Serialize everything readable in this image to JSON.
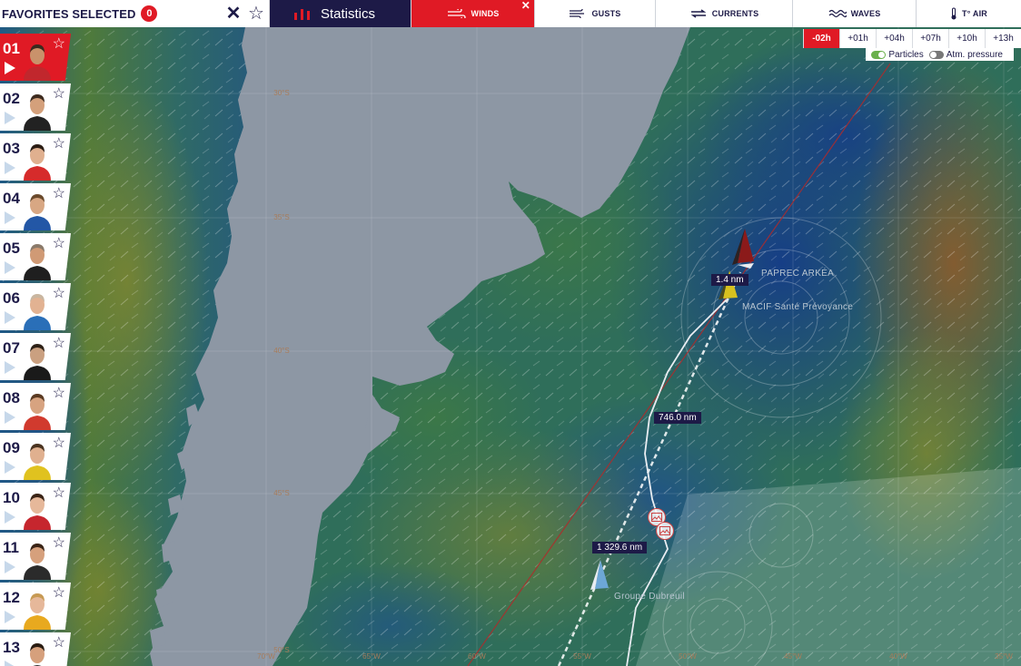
{
  "favorites": {
    "label": "FAVORITES SELECTED",
    "count": "0"
  },
  "stats_label": "Statistics",
  "layers": [
    {
      "label": "WINDS",
      "icon": "wind-icon",
      "active": true
    },
    {
      "label": "GUSTS",
      "icon": "gust-icon",
      "active": false
    },
    {
      "label": "CURRENTS",
      "icon": "currents-icon",
      "active": false
    },
    {
      "label": "WAVES",
      "icon": "waves-icon",
      "active": false
    },
    {
      "label": "T° AIR",
      "icon": "thermometer-icon",
      "active": false
    }
  ],
  "time_steps": [
    "-02h",
    "+01h",
    "+04h",
    "+07h",
    "+10h",
    "+13h"
  ],
  "active_time": "-02h",
  "toggles": [
    {
      "label": "Particles",
      "on": true
    },
    {
      "label": "Atm. pressure",
      "on": false
    }
  ],
  "skippers": [
    {
      "rank": "01",
      "jacket": "#c1272d",
      "skin": "#c9926b",
      "hair": "#3b2a1e"
    },
    {
      "rank": "02",
      "jacket": "#222222",
      "skin": "#d4a07b",
      "hair": "#3d2b1f"
    },
    {
      "rank": "03",
      "jacket": "#d62b2b",
      "skin": "#e0b08f",
      "hair": "#2b1d14"
    },
    {
      "rank": "04",
      "jacket": "#2357a6",
      "skin": "#d8a783",
      "hair": "#6a4a2c"
    },
    {
      "rank": "05",
      "jacket": "#1f1f1f",
      "skin": "#d09a75",
      "hair": "#8a7a6a"
    },
    {
      "rank": "06",
      "jacket": "#2a6fb8",
      "skin": "#e2b292",
      "hair": "#c9b6a0"
    },
    {
      "rank": "07",
      "jacket": "#1a1a1a",
      "skin": "#caa080",
      "hair": "#2d2016"
    },
    {
      "rank": "08",
      "jacket": "#d13a2e",
      "skin": "#d7a380",
      "hair": "#5a3a22"
    },
    {
      "rank": "09",
      "jacket": "#e0c21f",
      "skin": "#e0b08f",
      "hair": "#4a3320"
    },
    {
      "rank": "10",
      "jacket": "#c6262e",
      "skin": "#e6b89a",
      "hair": "#3a2416"
    },
    {
      "rank": "11",
      "jacket": "#2b2b2b",
      "skin": "#d6a07c",
      "hair": "#3a2416"
    },
    {
      "rank": "12",
      "jacket": "#e8a91f",
      "skin": "#e6b89a",
      "hair": "#c79a54"
    },
    {
      "rank": "13",
      "jacket": "#2b2b2b",
      "skin": "#d6a07c",
      "hair": "#2a1c12"
    }
  ],
  "lat_labels": [
    "30°S",
    "35°S",
    "40°S",
    "45°S",
    "50°S"
  ],
  "lon_labels": [
    "70°W",
    "65°W",
    "60°W",
    "55°W",
    "50°W",
    "45°W",
    "40°W",
    "35°W"
  ],
  "boats": [
    {
      "name": "PAPREC ARKÉA",
      "color": "#8b1a1a"
    },
    {
      "name": "MACIF Santé Prévoyance",
      "color": "#d7c11f"
    },
    {
      "name": "Groupe Dubreuil",
      "color": "#6da7d6"
    }
  ],
  "distances": [
    "1.4 nm",
    "746.0 nm",
    "1 329.6 nm"
  ],
  "colors": {
    "accent": "#e01a25",
    "navy": "#1d1a47"
  }
}
